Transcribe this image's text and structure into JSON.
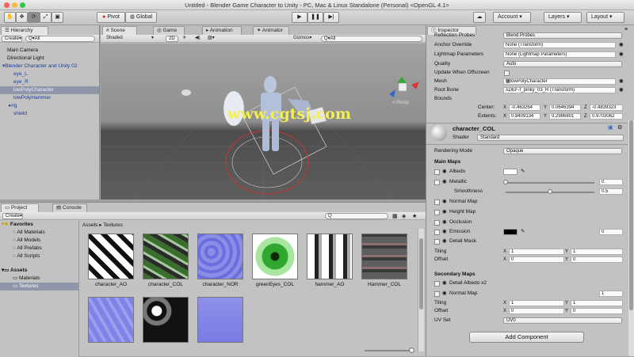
{
  "title": "Untitled - Blender Game Character to Unity - PC, Mac & Linux Standalone (Personal) <OpenGL 4.1>",
  "toolbar": {
    "pivot": "Pivot",
    "global": "Global",
    "account": "Account",
    "layers": "Layers",
    "layout": "Layout"
  },
  "hierarchy": {
    "tab": "Hierarchy",
    "create": "Create",
    "search": "Q▾All",
    "items": [
      "Main Camera",
      "Directional Light",
      "Blender Character and Unity 02",
      "eye_L",
      "eye_R",
      "lowPolyCharacter",
      "lowPolyHammer",
      "rig",
      "shield"
    ]
  },
  "scene": {
    "tabs": [
      "Scene",
      "Game",
      "Animation",
      "Animator"
    ],
    "shaded": "Shaded",
    "twod": "2D",
    "gizmos": "Gizmos",
    "search": "Q▾All",
    "persp": "< Persp",
    "watermark": "www.cgtsj.com"
  },
  "project": {
    "tabs": [
      "Project",
      "Console"
    ],
    "create": "Create",
    "breadcrumb": "Assets ▸ Textures",
    "favorites": "Favorites",
    "fav_items": [
      "All Materials",
      "All Models",
      "All Prefabs",
      "All Scripts"
    ],
    "assets": "Assets",
    "asset_items": [
      "Materials",
      "Textures"
    ],
    "thumbs": [
      "character_AO",
      "character_COL",
      "character_NOR",
      "greenEyes_COL",
      "hammer_AO",
      "Hammer_COL"
    ]
  },
  "inspector": {
    "tab": "Inspector",
    "props": [
      {
        "label": "Reflection Probes",
        "value": "Blend Probes"
      },
      {
        "label": "Anchor Override",
        "value": "None (Transform)"
      },
      {
        "label": "Lightmap Parameters",
        "value": "None (Lightmap Parameters)"
      },
      {
        "label": "Quality",
        "value": "Auto"
      },
      {
        "label": "Update When Offscreen",
        "value": ""
      },
      {
        "label": "Mesh",
        "value": "lowPolyCharacter"
      },
      {
        "label": "Root Bone",
        "value": "DEF-f_pinky_03_R (Transform)"
      },
      {
        "label": "Bounds",
        "value": ""
      }
    ],
    "center_label": "Center:",
    "extents_label": "Extents:",
    "center": {
      "x": "-0.463264",
      "y": "0.0646394",
      "z": "-0.4839323"
    },
    "extents": {
      "x": "0.8409134",
      "y": "0.2986801",
      "z": "0.9703062"
    },
    "material": "character_COL",
    "shader_label": "Shader",
    "shader": "Standard",
    "rendering_mode_label": "Rendering Mode",
    "rendering_mode": "Opaque",
    "main_maps": "Main Maps",
    "albedo": "Albedo",
    "metallic": "Metallic",
    "metallic_val": "0",
    "smoothness": "Smoothness",
    "smoothness_val": "0.5",
    "normal_map": "Normal Map",
    "height_map": "Height Map",
    "occlusion": "Occlusion",
    "emission": "Emission",
    "emission_val": "0",
    "detail_mask": "Detail Mask",
    "tiling": "Tiling",
    "offset": "Offset",
    "tiling_x": "1",
    "tiling_y": "1",
    "offset_x": "0",
    "offset_y": "0",
    "secondary_maps": "Secondary Maps",
    "detail_albedo": "Detail Albedo x2",
    "sec_normal": "Normal Map",
    "sec_normal_val": "1",
    "sec_tiling_x": "1",
    "sec_tiling_y": "1",
    "sec_offset_x": "0",
    "sec_offset_y": "0",
    "uv_set_label": "UV Set",
    "uv_set": "UV0",
    "add_component": "Add Component"
  },
  "axis_labels": {
    "x": "X",
    "y": "Y",
    "z": "Z"
  }
}
